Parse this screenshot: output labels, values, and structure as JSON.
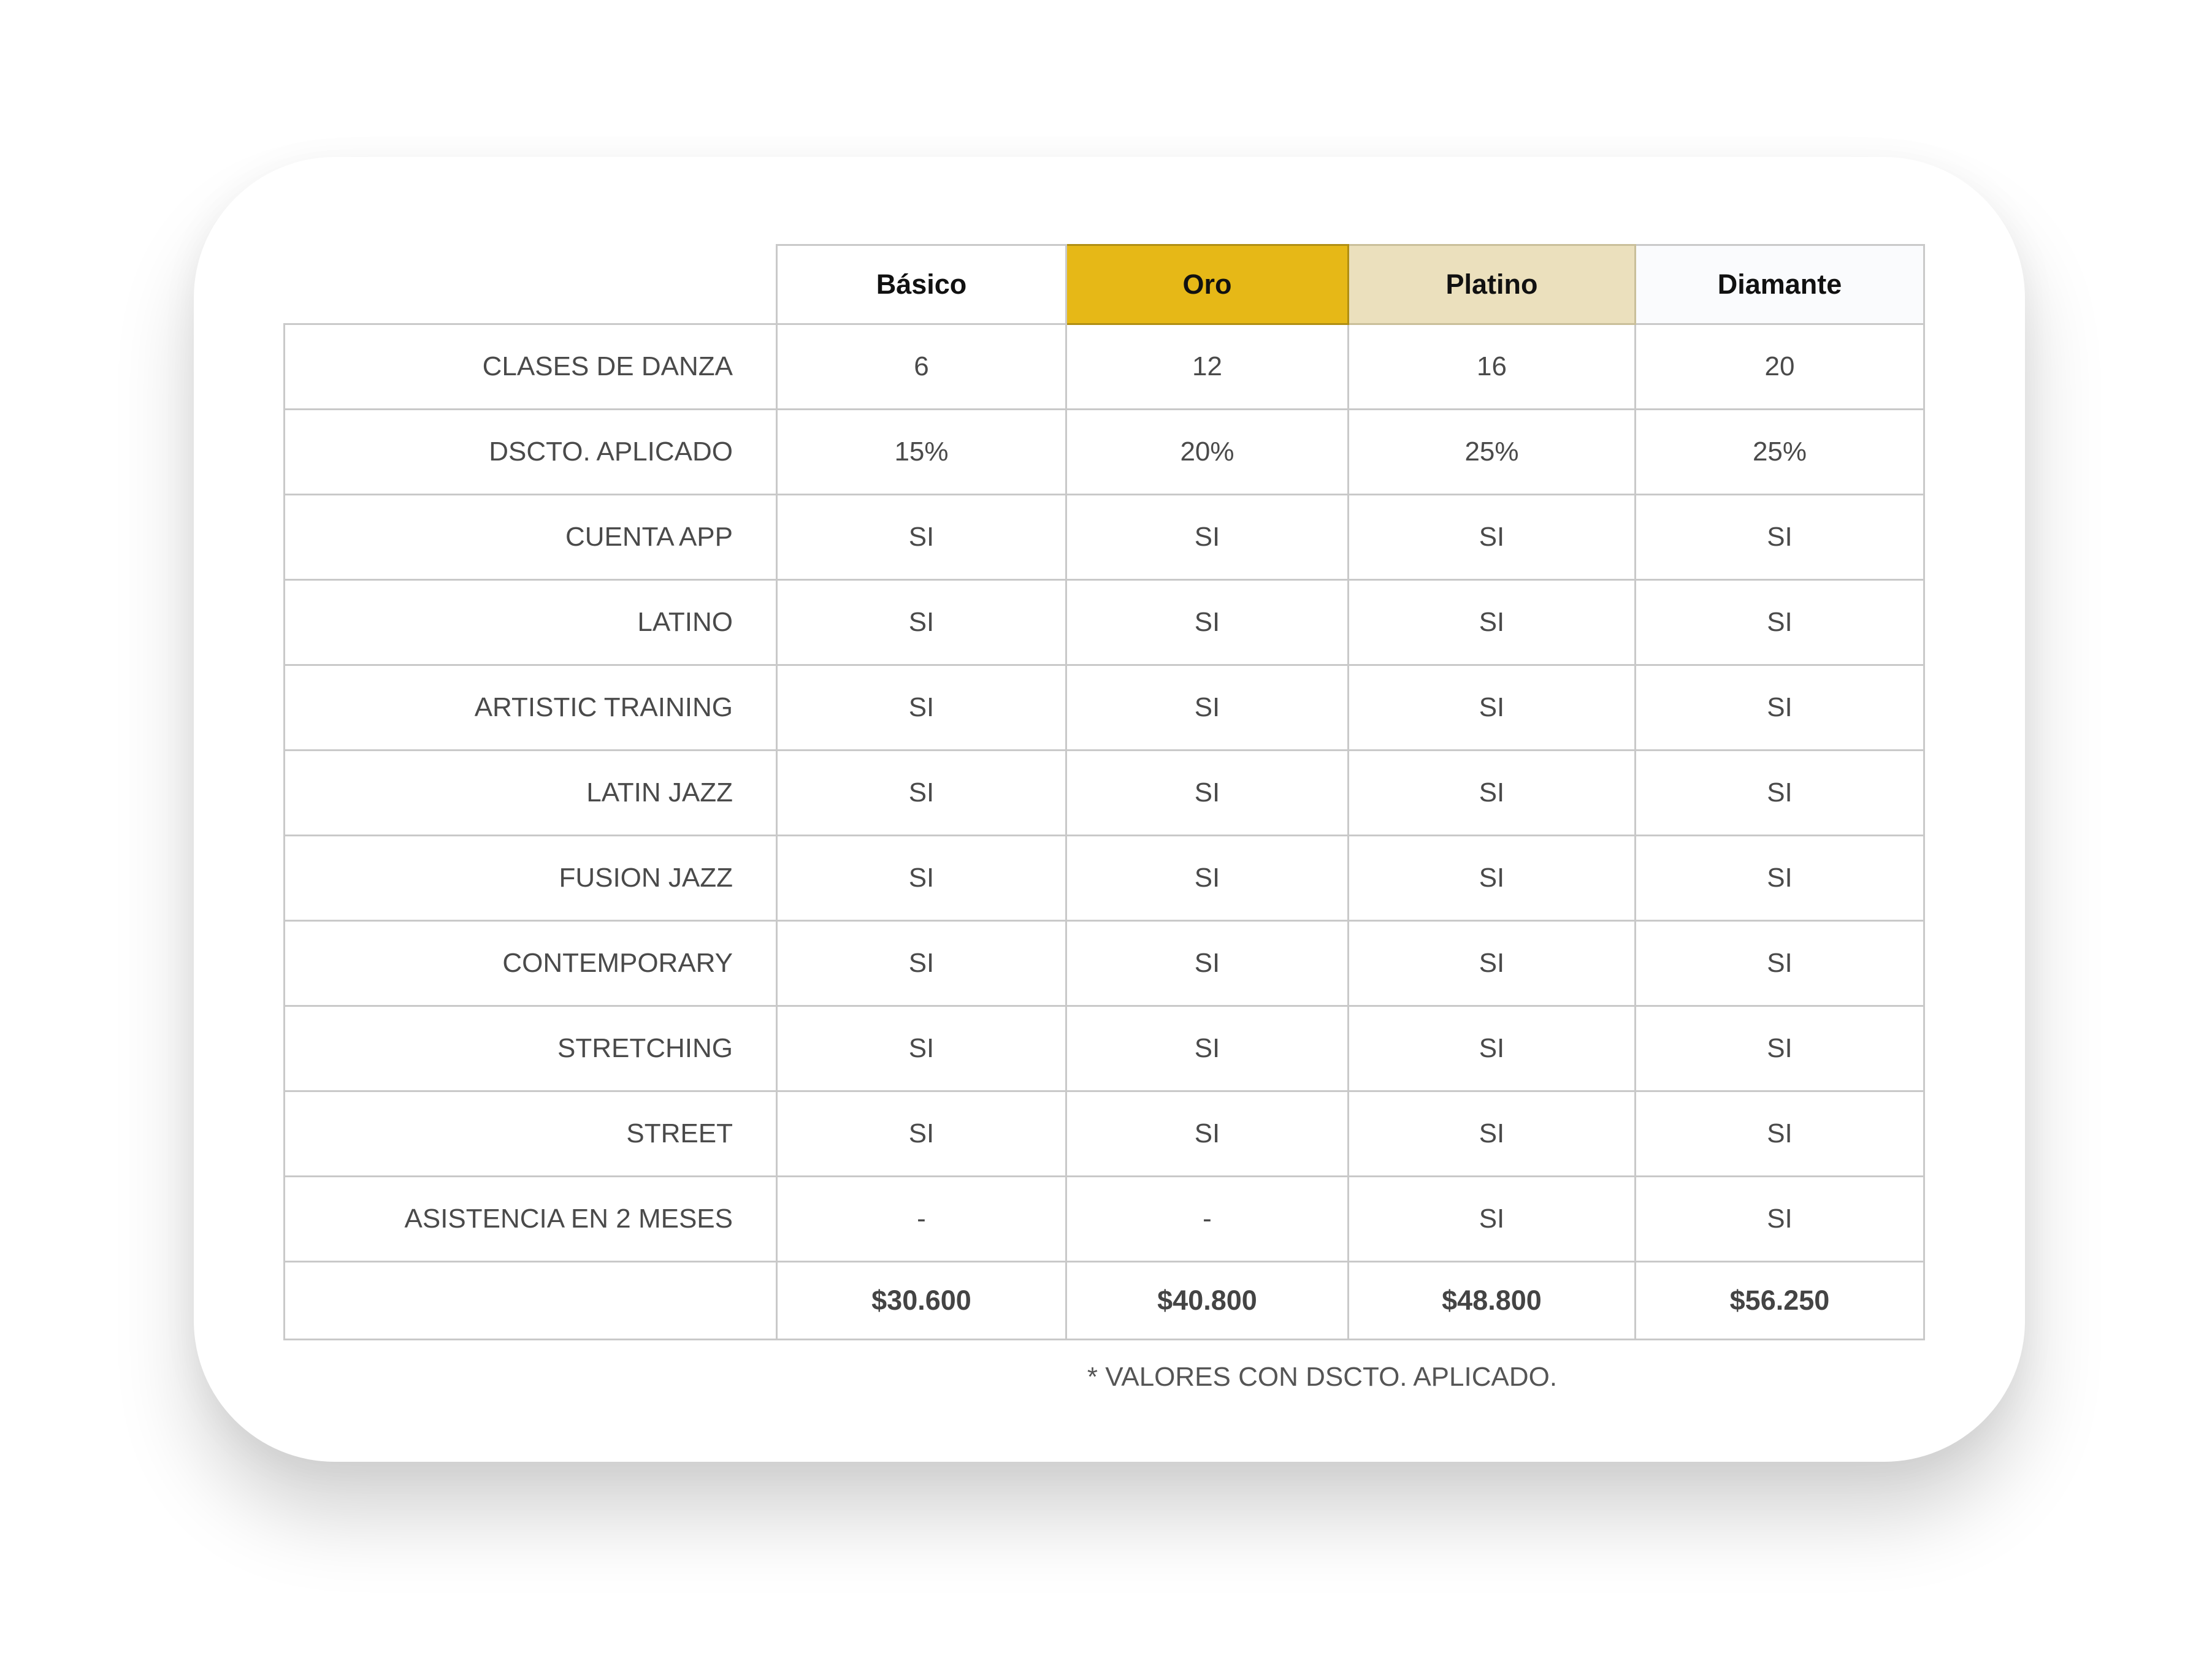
{
  "table": {
    "headers": [
      "Básico",
      "Oro",
      "Platino",
      "Diamante"
    ],
    "rows": [
      {
        "label": "CLASES DE DANZA",
        "values": [
          "6",
          "12",
          "16",
          "20"
        ]
      },
      {
        "label": "DSCTO. APLICADO",
        "values": [
          "15%",
          "20%",
          "25%",
          "25%"
        ]
      },
      {
        "label": "CUENTA APP",
        "values": [
          "SI",
          "SI",
          "SI",
          "SI"
        ]
      },
      {
        "label": "LATINO",
        "values": [
          "SI",
          "SI",
          "SI",
          "SI"
        ]
      },
      {
        "label": "ARTISTIC TRAINING",
        "values": [
          "SI",
          "SI",
          "SI",
          "SI"
        ]
      },
      {
        "label": "LATIN JAZZ",
        "values": [
          "SI",
          "SI",
          "SI",
          "SI"
        ]
      },
      {
        "label": "FUSION JAZZ",
        "values": [
          "SI",
          "SI",
          "SI",
          "SI"
        ]
      },
      {
        "label": "CONTEMPORARY",
        "values": [
          "SI",
          "SI",
          "SI",
          "SI"
        ]
      },
      {
        "label": "STRETCHING",
        "values": [
          "SI",
          "SI",
          "SI",
          "SI"
        ]
      },
      {
        "label": "STREET",
        "values": [
          "SI",
          "SI",
          "SI",
          "SI"
        ]
      },
      {
        "label": "ASISTENCIA EN 2 MESES",
        "values": [
          "-",
          "-",
          "SI",
          "SI"
        ]
      }
    ],
    "totals": [
      "$30.600",
      "$40.800",
      "$48.800",
      "$56.250"
    ]
  },
  "footnote": "* VALORES CON DSCTO. APLICADO.",
  "colors": {
    "oro": "#e6b817",
    "platino": "#ebe0bd",
    "diamante": "#fafbfd",
    "grid": "#c9c9c9"
  }
}
